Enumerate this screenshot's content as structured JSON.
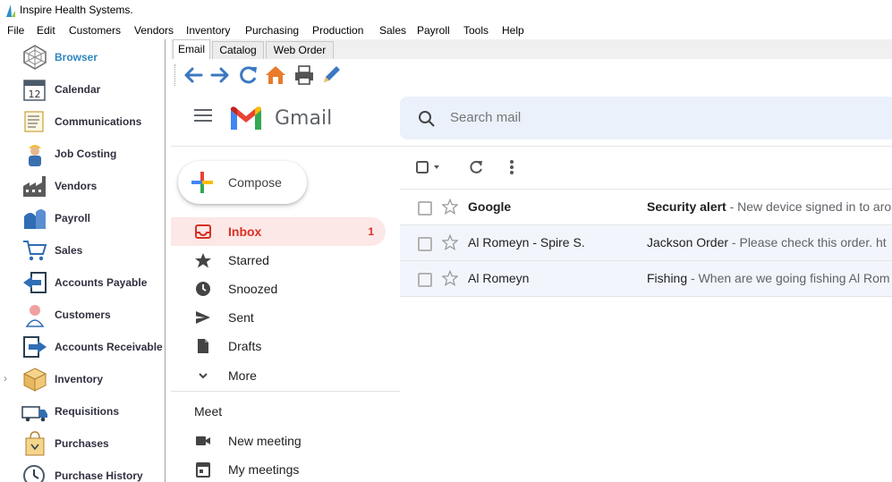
{
  "window": {
    "title": "Inspire Health Systems."
  },
  "menu": [
    "File",
    "Edit",
    "Customers",
    "Vendors",
    "Inventory",
    "Purchasing",
    "Production",
    "Sales",
    "Payroll",
    "Tools",
    "Help"
  ],
  "sidebar": {
    "items": [
      {
        "label": "Browser",
        "icon": "browser-icon",
        "active": true
      },
      {
        "label": "Calendar",
        "icon": "calendar-icon"
      },
      {
        "label": "Communications",
        "icon": "communications-icon"
      },
      {
        "label": "Job Costing",
        "icon": "worker-icon"
      },
      {
        "label": "Vendors",
        "icon": "factory-icon"
      },
      {
        "label": "Payroll",
        "icon": "payroll-icon"
      },
      {
        "label": "Sales",
        "icon": "cart-icon"
      },
      {
        "label": "Accounts Payable",
        "icon": "payable-icon"
      },
      {
        "label": "Customers",
        "icon": "customer-icon"
      },
      {
        "label": "Accounts Receivable",
        "icon": "receivable-icon"
      },
      {
        "label": "Inventory",
        "icon": "box-icon"
      },
      {
        "label": "Requisitions",
        "icon": "truck-icon"
      },
      {
        "label": "Purchases",
        "icon": "bag-icon"
      },
      {
        "label": "Purchase History",
        "icon": "clock-icon"
      }
    ],
    "calendar_day": "12",
    "expander": "›"
  },
  "tabs": [
    "Email",
    "Catalog",
    "Web Order"
  ],
  "toolbar": [
    "back-arrow-icon",
    "forward-arrow-icon",
    "refresh-icon",
    "home-icon",
    "print-icon",
    "edit-pencil-icon"
  ],
  "gmail": {
    "logo_text": "Gmail",
    "search_placeholder": "Search mail",
    "compose": "Compose",
    "folders": [
      {
        "label": "Inbox",
        "count": "1",
        "icon": "inbox-icon",
        "active": true
      },
      {
        "label": "Starred",
        "icon": "star-icon"
      },
      {
        "label": "Snoozed",
        "icon": "clock-icon"
      },
      {
        "label": "Sent",
        "icon": "send-icon"
      },
      {
        "label": "Drafts",
        "icon": "draft-icon"
      },
      {
        "label": "More",
        "icon": "chevron-down-icon"
      }
    ],
    "meet": {
      "title": "Meet",
      "items": [
        {
          "label": "New meeting",
          "icon": "video-icon"
        },
        {
          "label": "My meetings",
          "icon": "calendar-icon"
        }
      ]
    },
    "emails": [
      {
        "sender": "Google",
        "subject": "Security alert",
        "snippet": " - New device signed in to aro",
        "unread": true
      },
      {
        "sender": "Al Romeyn - Spire S.",
        "subject": "Jackson Order",
        "snippet": " - Please check this order. ht",
        "unread": false
      },
      {
        "sender": "Al Romeyn",
        "subject": "Fishing",
        "snippet": " - When are we going fishing Al Rom",
        "unread": false
      }
    ]
  },
  "colors": {
    "accent_blue": "#2e86c1",
    "gmail_red": "#d93025",
    "inbox_highlight": "#fce8e6"
  }
}
